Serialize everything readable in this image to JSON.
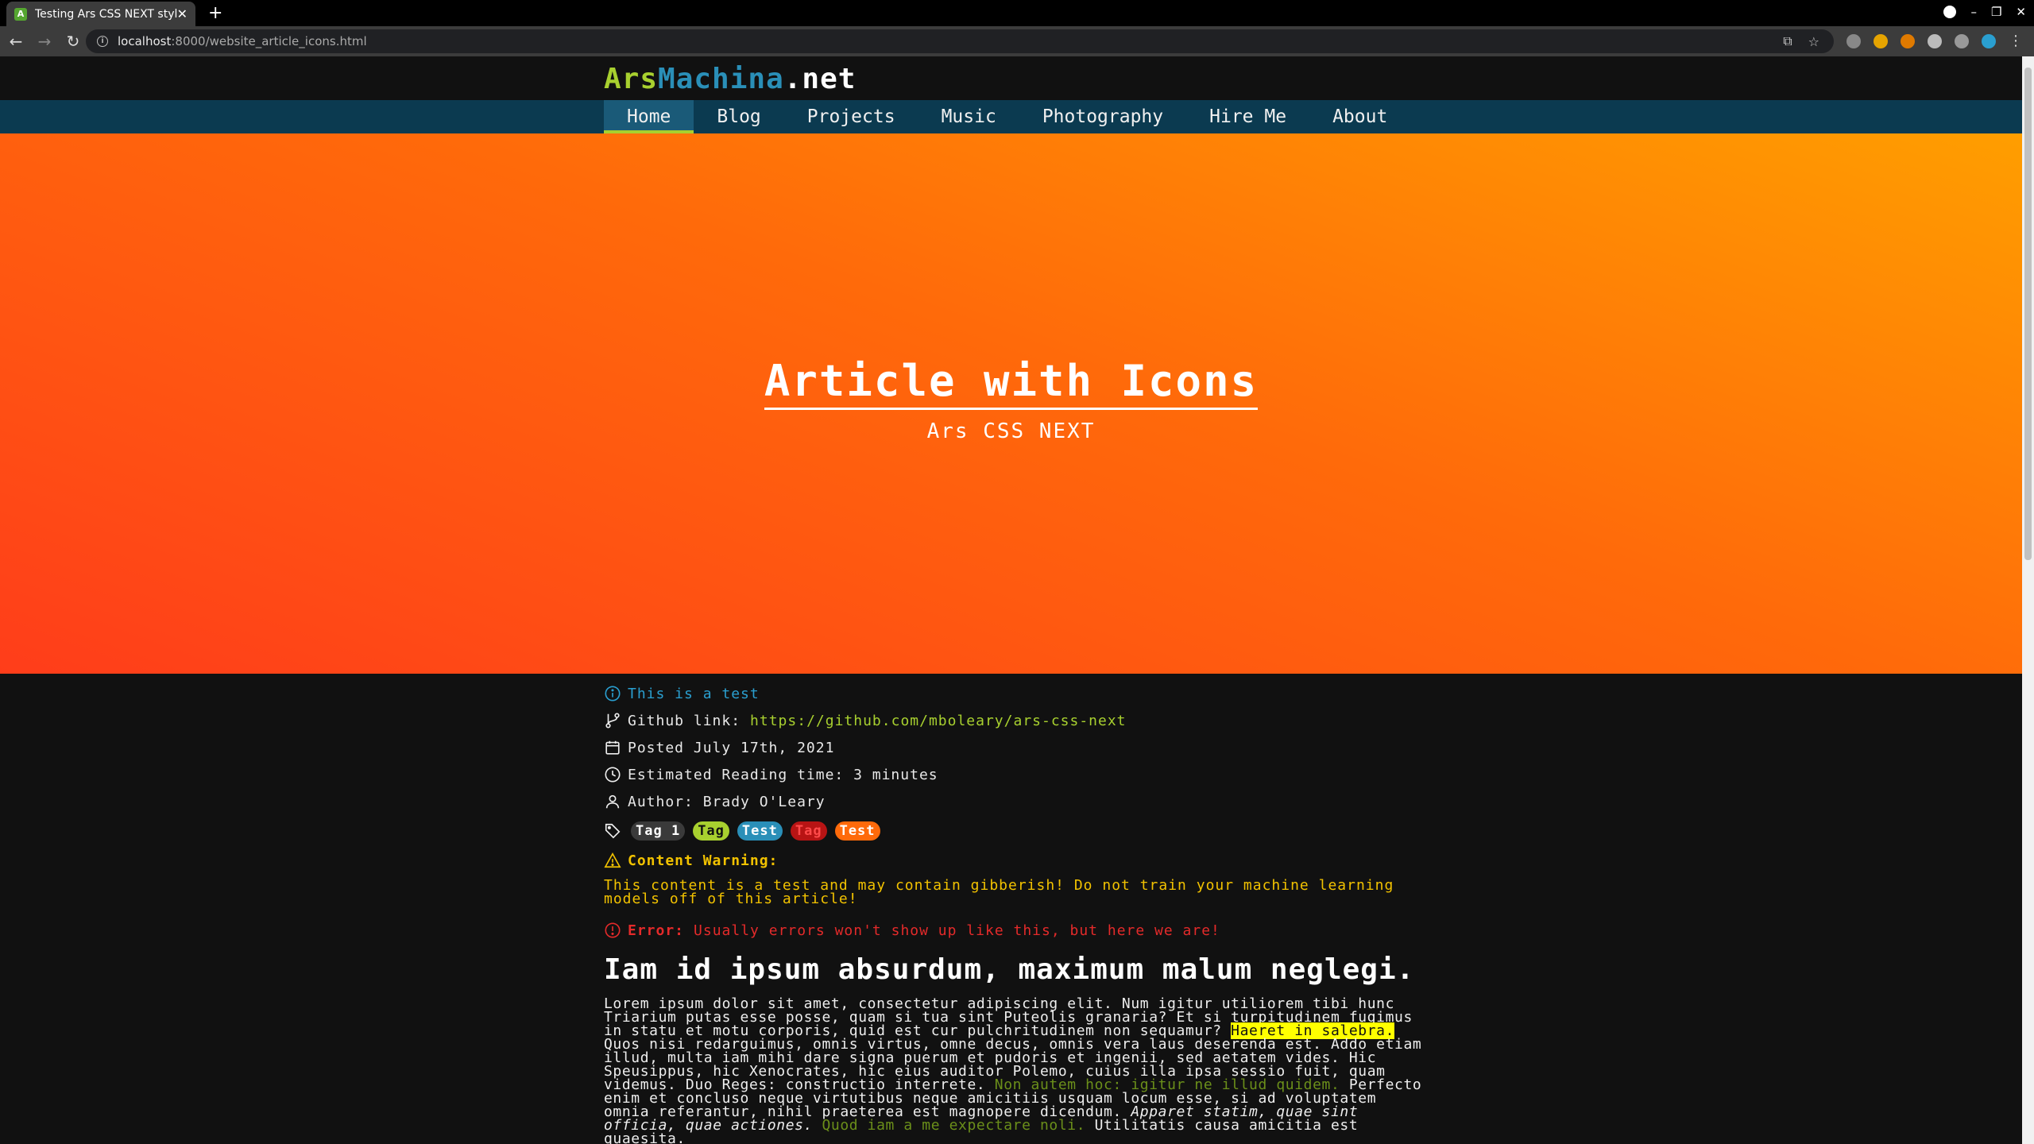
{
  "browser": {
    "tab_title": "Testing Ars CSS NEXT styling",
    "favicon_letter": "A",
    "url_host": "localhost",
    "url_path": ":8000/website_article_icons.html"
  },
  "site": {
    "logo_ars": "Ars",
    "logo_machina": "Machina",
    "logo_net": ".net",
    "nav": [
      "Home",
      "Blog",
      "Projects",
      "Music",
      "Photography",
      "Hire Me",
      "About"
    ]
  },
  "hero": {
    "title": "Article with Icons",
    "subtitle": "Ars CSS NEXT"
  },
  "meta": {
    "info": "This is a test",
    "github_label": "Github link:",
    "github_url": "https://github.com/mboleary/ars-css-next",
    "posted": "Posted July 17th, 2021",
    "reading_time": "Estimated Reading time: 3 minutes",
    "author": "Author: Brady O'Leary",
    "tags": [
      {
        "label": "Tag 1",
        "bg": "#3a3a3a",
        "fg": "#ffffff"
      },
      {
        "label": "Tag",
        "bg": "#a8d02f",
        "fg": "#111111"
      },
      {
        "label": "Test",
        "bg": "#2a8fb8",
        "fg": "#ffffff"
      },
      {
        "label": "Tag",
        "bg": "#b81414",
        "fg": "#ff4a4a"
      },
      {
        "label": "Test",
        "bg": "#ff6a0a",
        "fg": "#ffffff"
      }
    ],
    "warning_label": "Content Warning:",
    "warning_text": "This content is a test and may contain gibberish! Do not train your machine learning models off of this article!",
    "error_label": "Error:",
    "error_text": "Usually errors won't show up like this, but here we are!"
  },
  "article": {
    "heading": "Iam id ipsum absurdum, maximum malum neglegi.",
    "p1": "Lorem ipsum dolor sit amet, consectetur adipiscing elit. Num igitur utiliorem tibi hunc Triarium putas esse posse, quam si tua sint Puteolis granaria? Et si turpitudinem fugimus in statu et motu corporis, quid est cur pulchritudinem non sequamur?",
    "highlight": "Haeret in salebra.",
    "p2": "Quos nisi redarguimus, omnis virtus, omne decus, omnis vera laus deserenda est. Addo etiam illud, multa iam mihi dare signa puerum et pudoris et ingenii, sed aetatem vides. Hic Speusippus, hic Xenocrates, hic eius auditor Polemo, cuius illa ipsa sessio fuit, quam videmus. Duo Reges: constructio interrete.",
    "green1": "Non autem hoc: igitur ne illud quidem.",
    "p3": "Perfecto enim et concluso neque virtutibus neque amicitiis usquam locum esse, si ad voluptatem omnia referantur, nihil praeterea est magnopere dicendum.",
    "italic": "Apparet statim, quae sint officia, quae actiones.",
    "green2": "Quod iam a me expectare noli.",
    "p4": "Utilitatis causa amicitia est quaesita."
  }
}
